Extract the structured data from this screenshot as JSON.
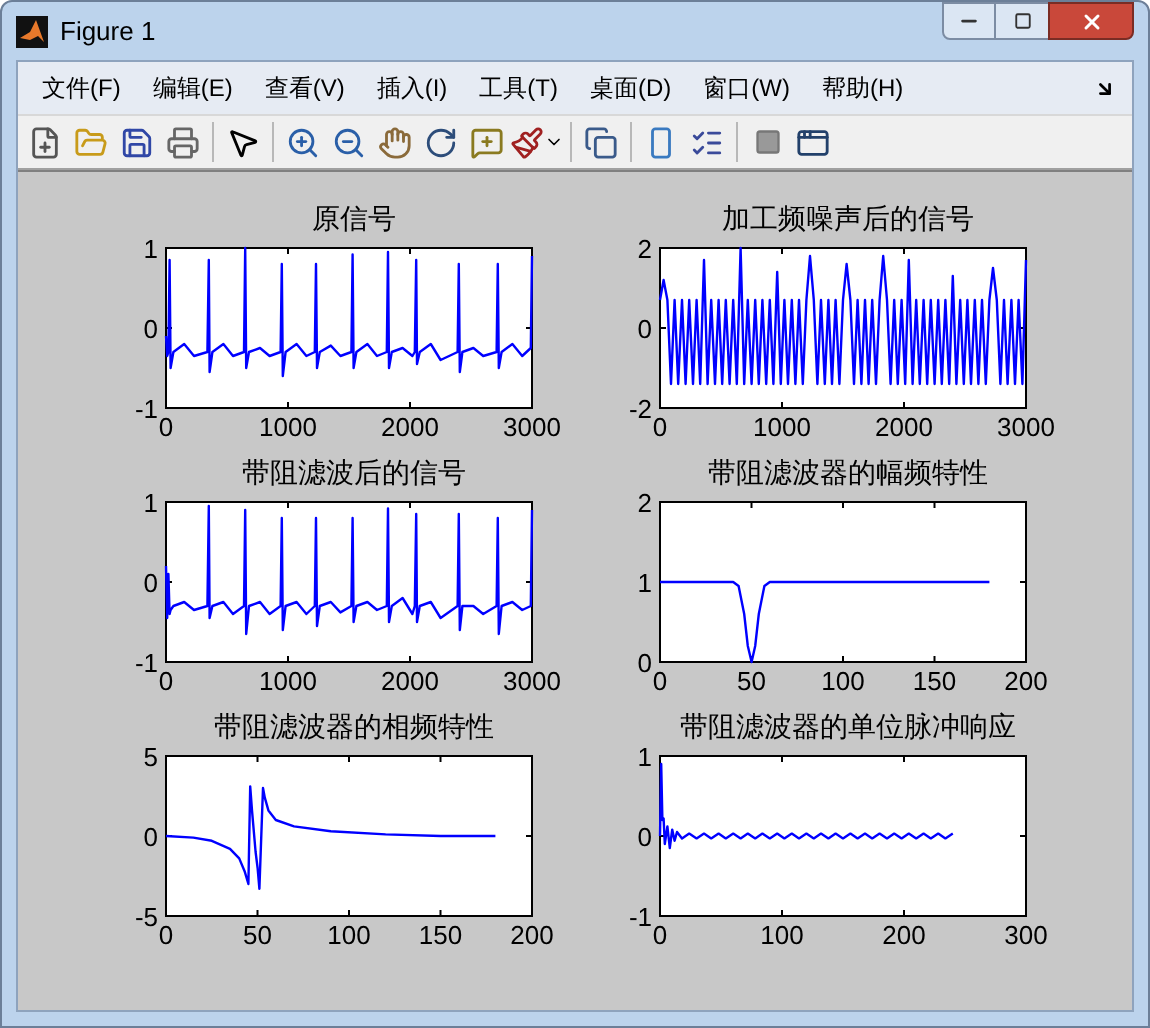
{
  "window": {
    "title": "Figure 1"
  },
  "menu": [
    "文件(F)",
    "编辑(E)",
    "查看(V)",
    "插入(I)",
    "工具(T)",
    "桌面(D)",
    "窗口(W)",
    "帮助(H)"
  ],
  "panels": [
    {
      "chart_data": {
        "type": "line",
        "title": "原信号",
        "xlim": [
          0,
          3000
        ],
        "ylim": [
          -1,
          1
        ],
        "xticks": [
          0,
          1000,
          2000,
          3000
        ],
        "yticks": [
          -1,
          0,
          1
        ],
        "x": [
          0,
          10,
          20,
          30,
          38,
          60,
          150,
          230,
          340,
          350,
          358,
          380,
          470,
          550,
          640,
          650,
          658,
          680,
          770,
          850,
          940,
          950,
          958,
          980,
          1070,
          1150,
          1220,
          1230,
          1238,
          1260,
          1350,
          1430,
          1520,
          1530,
          1538,
          1560,
          1650,
          1730,
          1810,
          1820,
          1828,
          1850,
          1940,
          2020,
          2040,
          2050,
          2058,
          2080,
          2170,
          2250,
          2390,
          2400,
          2408,
          2430,
          2520,
          2600,
          2710,
          2720,
          2728,
          2750,
          2840,
          2920,
          2990,
          3000
        ],
        "series": [
          {
            "color": "#0000ff",
            "values": [
              -0.1,
              -0.35,
              -0.3,
              0.85,
              -0.5,
              -0.3,
              -0.2,
              -0.35,
              -0.3,
              0.85,
              -0.55,
              -0.3,
              -0.2,
              -0.35,
              -0.3,
              1,
              -0.5,
              -0.3,
              -0.25,
              -0.35,
              -0.3,
              0.8,
              -0.6,
              -0.3,
              -0.2,
              -0.35,
              -0.3,
              0.8,
              -0.5,
              -0.3,
              -0.22,
              -0.35,
              -0.3,
              0.92,
              -0.5,
              -0.3,
              -0.2,
              -0.35,
              -0.3,
              0.95,
              -0.5,
              -0.3,
              -0.25,
              -0.35,
              -0.3,
              0.85,
              -0.45,
              -0.3,
              -0.2,
              -0.4,
              -0.3,
              0.8,
              -0.55,
              -0.3,
              -0.25,
              -0.35,
              -0.3,
              0.8,
              -0.5,
              -0.3,
              -0.2,
              -0.35,
              -0.25,
              0.9
            ]
          }
        ]
      }
    },
    {
      "chart_data": {
        "type": "line",
        "title": "加工频噪声后的信号",
        "xlim": [
          0,
          3000
        ],
        "ylim": [
          -2,
          2
        ],
        "xticks": [
          0,
          1000,
          2000,
          3000
        ],
        "yticks": [
          -2,
          0,
          2
        ],
        "x": [
          0,
          30,
          60,
          90,
          120,
          150,
          180,
          210,
          240,
          270,
          300,
          330,
          360,
          390,
          420,
          450,
          480,
          510,
          540,
          570,
          600,
          630,
          660,
          690,
          720,
          750,
          780,
          810,
          840,
          870,
          900,
          930,
          960,
          990,
          1020,
          1050,
          1080,
          1110,
          1140,
          1170,
          1200,
          1230,
          1260,
          1290,
          1320,
          1350,
          1380,
          1410,
          1440,
          1470,
          1500,
          1530,
          1560,
          1590,
          1620,
          1650,
          1680,
          1710,
          1740,
          1770,
          1800,
          1830,
          1860,
          1890,
          1920,
          1950,
          1980,
          2010,
          2040,
          2070,
          2100,
          2130,
          2160,
          2190,
          2220,
          2250,
          2280,
          2310,
          2340,
          2370,
          2400,
          2430,
          2460,
          2490,
          2520,
          2550,
          2580,
          2610,
          2640,
          2670,
          2700,
          2730,
          2760,
          2790,
          2820,
          2850,
          2880,
          2910,
          2940,
          2970,
          3000
        ],
        "series": [
          {
            "color": "#0000ff",
            "values": [
              0.7,
              1.2,
              0.7,
              -1.4,
              0.7,
              -1.4,
              0.7,
              -1.4,
              0.7,
              -1.4,
              0.7,
              -1.4,
              1.7,
              -1.4,
              0.7,
              -1.4,
              0.7,
              -1.4,
              0.7,
              -1.4,
              0.7,
              -1.4,
              2,
              -1.4,
              0.7,
              -1.4,
              0.7,
              -1.4,
              0.7,
              -1.4,
              0.7,
              -1.4,
              1.4,
              -1.4,
              0.7,
              -1.4,
              0.7,
              -1.4,
              0.7,
              -1.4,
              0.7,
              1.8,
              0.7,
              -1.4,
              0.7,
              -1.4,
              0.7,
              -1.4,
              0.7,
              -1.4,
              0.7,
              1.6,
              0.7,
              -1.4,
              0.7,
              -1.4,
              0.7,
              -1.4,
              0.7,
              -1.4,
              0.7,
              1.8,
              0.7,
              -1.4,
              0.7,
              -1.4,
              0.7,
              -1.4,
              1.7,
              -1.4,
              0.7,
              -1.4,
              0.7,
              -1.4,
              0.7,
              -1.4,
              0.7,
              -1.4,
              0.7,
              -1.4,
              1.3,
              -1.4,
              0.7,
              -1.4,
              0.7,
              -1.4,
              0.7,
              -1.4,
              0.7,
              -1.4,
              0.7,
              1.5,
              0.7,
              -1.4,
              0.7,
              -1.4,
              0.7,
              -1.4,
              0.7,
              -1.4,
              1.7
            ]
          }
        ]
      }
    },
    {
      "chart_data": {
        "type": "line",
        "title": "带阻滤波后的信号",
        "xlim": [
          0,
          3000
        ],
        "ylim": [
          -1,
          1
        ],
        "xticks": [
          0,
          1000,
          2000,
          3000
        ],
        "yticks": [
          -1,
          0,
          1
        ],
        "x": [
          0,
          10,
          20,
          30,
          38,
          60,
          150,
          230,
          340,
          350,
          358,
          380,
          470,
          550,
          640,
          650,
          658,
          680,
          770,
          850,
          940,
          950,
          958,
          980,
          1070,
          1150,
          1220,
          1230,
          1238,
          1260,
          1350,
          1430,
          1520,
          1530,
          1538,
          1560,
          1650,
          1730,
          1810,
          1820,
          1828,
          1850,
          1940,
          2020,
          2040,
          2050,
          2058,
          2080,
          2170,
          2250,
          2390,
          2400,
          2408,
          2430,
          2520,
          2600,
          2710,
          2720,
          2728,
          2750,
          2840,
          2920,
          2990,
          3000
        ],
        "series": [
          {
            "color": "#0000ff",
            "values": [
              0.2,
              -0.45,
              0.1,
              -0.4,
              -0.35,
              -0.3,
              -0.25,
              -0.35,
              -0.3,
              0.95,
              -0.45,
              -0.3,
              -0.25,
              -0.4,
              -0.3,
              0.9,
              -0.65,
              -0.3,
              -0.25,
              -0.4,
              -0.3,
              0.8,
              -0.6,
              -0.3,
              -0.25,
              -0.4,
              -0.3,
              0.8,
              -0.55,
              -0.3,
              -0.25,
              -0.38,
              -0.3,
              0.8,
              -0.5,
              -0.3,
              -0.25,
              -0.35,
              -0.3,
              0.92,
              -0.5,
              -0.3,
              -0.2,
              -0.4,
              -0.3,
              0.85,
              -0.5,
              -0.3,
              -0.25,
              -0.45,
              -0.3,
              0.85,
              -0.6,
              -0.3,
              -0.3,
              -0.4,
              -0.3,
              0.8,
              -0.65,
              -0.3,
              -0.25,
              -0.35,
              -0.3,
              0.9
            ]
          }
        ]
      }
    },
    {
      "chart_data": {
        "type": "line",
        "title": "带阻滤波器的幅频特性",
        "xlim": [
          0,
          200
        ],
        "ylim": [
          0,
          2
        ],
        "xticks": [
          0,
          50,
          100,
          150,
          200
        ],
        "yticks": [
          0,
          1,
          2
        ],
        "x": [
          0,
          40,
          43,
          46,
          48,
          50,
          52,
          54,
          57,
          60,
          180
        ],
        "series": [
          {
            "color": "#0000ff",
            "values": [
              1,
              1,
              0.95,
              0.6,
              0.2,
              0,
              0.2,
              0.6,
              0.95,
              1,
              1
            ]
          }
        ]
      }
    },
    {
      "chart_data": {
        "type": "line",
        "title": "带阻滤波器的相频特性",
        "xlim": [
          0,
          200
        ],
        "ylim": [
          -5,
          5
        ],
        "xticks": [
          0,
          50,
          100,
          150,
          200
        ],
        "yticks": [
          -5,
          0,
          5
        ],
        "x": [
          0,
          15,
          25,
          35,
          40,
          43,
          45,
          46,
          47,
          49,
          50,
          51,
          53,
          54,
          56,
          60,
          70,
          90,
          120,
          150,
          180
        ],
        "series": [
          {
            "color": "#0000ff",
            "values": [
              0,
              -0.1,
              -0.3,
              -0.8,
              -1.4,
              -2.2,
              -3,
              3.1,
              1.6,
              -1,
              -2,
              -3.3,
              3,
              2.4,
              1.6,
              1,
              0.6,
              0.3,
              0.1,
              0,
              0
            ]
          }
        ]
      }
    },
    {
      "chart_data": {
        "type": "line",
        "title": "带阻滤波器的单位脉冲响应",
        "xlim": [
          0,
          300
        ],
        "ylim": [
          -1,
          1
        ],
        "xticks": [
          0,
          100,
          200,
          300
        ],
        "yticks": [
          -1,
          0,
          1
        ],
        "x": [
          0,
          1,
          2,
          3,
          4,
          6,
          8,
          10,
          12,
          14,
          18,
          24,
          30,
          36,
          42,
          48,
          54,
          60,
          66,
          72,
          78,
          84,
          90,
          96,
          102,
          108,
          114,
          120,
          126,
          132,
          138,
          144,
          150,
          156,
          162,
          168,
          174,
          180,
          186,
          192,
          198,
          204,
          210,
          216,
          222,
          228,
          234,
          240
        ],
        "series": [
          {
            "color": "#0000ff",
            "values": [
              0,
              0.9,
              0.2,
              0.22,
              -0.1,
              0.12,
              -0.15,
              0.08,
              -0.06,
              0.05,
              -0.03,
              0.03,
              -0.03,
              0.03,
              -0.03,
              0.03,
              -0.03,
              0.03,
              -0.03,
              0.03,
              -0.03,
              0.03,
              -0.03,
              0.03,
              -0.03,
              0.03,
              -0.03,
              0.03,
              -0.03,
              0.03,
              -0.03,
              0.03,
              -0.03,
              0.03,
              -0.03,
              0.03,
              -0.03,
              0.03,
              -0.03,
              0.03,
              -0.03,
              0.03,
              -0.03,
              0.03,
              -0.03,
              0.03,
              -0.03,
              0.03
            ]
          }
        ]
      }
    }
  ]
}
